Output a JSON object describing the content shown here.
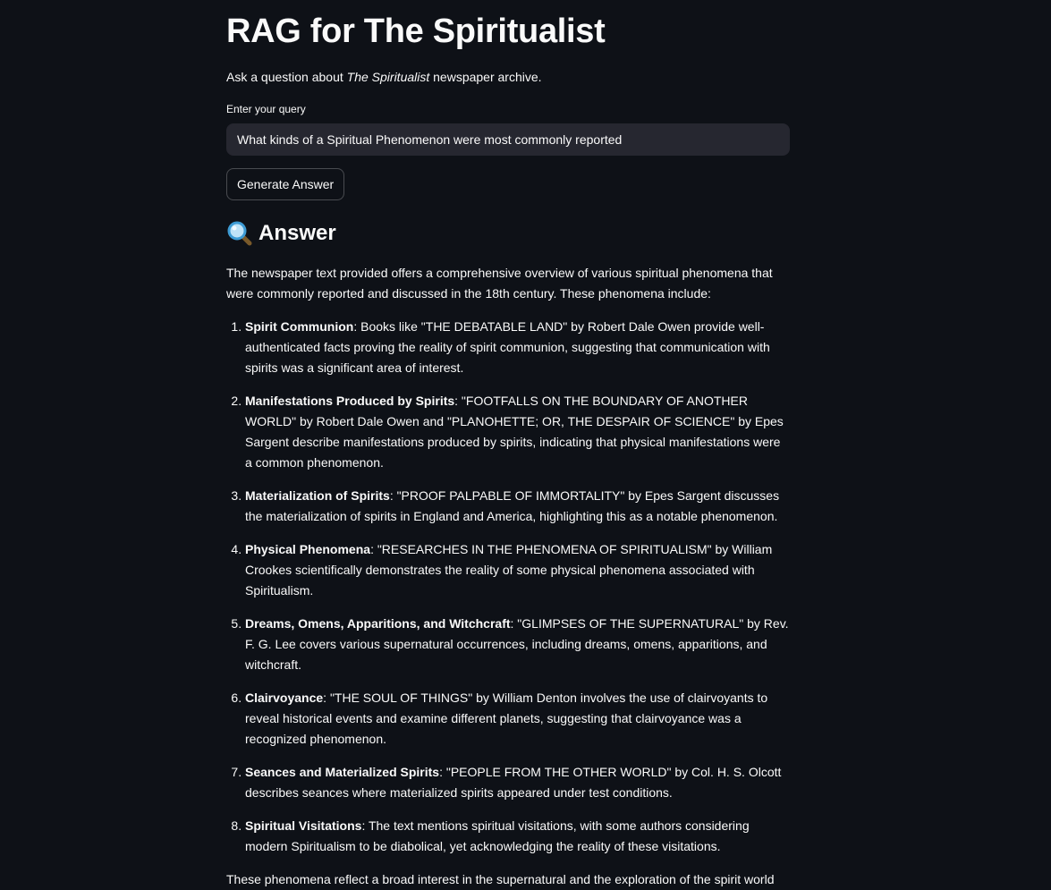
{
  "header": {
    "title": "RAG for The Spiritualist",
    "subtitle_before": "Ask a question about ",
    "subtitle_em": "The Spiritualist",
    "subtitle_after": " newspaper archive."
  },
  "query": {
    "label": "Enter your query",
    "value": "What kinds of a Spiritual Phenomenon were most commonly reported"
  },
  "button": {
    "label": "Generate Answer"
  },
  "answer": {
    "heading": "Answer",
    "icon": "magnifying-glass-icon",
    "intro": "The newspaper text provided offers a comprehensive overview of various spiritual phenomena that were commonly reported and discussed in the 18th century. These phenomena include:",
    "items": [
      {
        "title": "Spirit Communion",
        "text": ": Books like \"THE DEBATABLE LAND\" by Robert Dale Owen provide well-authenticated facts proving the reality of spirit communion, suggesting that communication with spirits was a significant area of interest."
      },
      {
        "title": "Manifestations Produced by Spirits",
        "text": ": \"FOOTFALLS ON THE BOUNDARY OF ANOTHER WORLD\" by Robert Dale Owen and \"PLANOHETTE; OR, THE DESPAIR OF SCIENCE\" by Epes Sargent describe manifestations produced by spirits, indicating that physical manifestations were a common phenomenon."
      },
      {
        "title": "Materialization of Spirits",
        "text": ": \"PROOF PALPABLE OF IMMORTALITY\" by Epes Sargent discusses the materialization of spirits in England and America, highlighting this as a notable phenomenon."
      },
      {
        "title": "Physical Phenomena",
        "text": ": \"RESEARCHES IN THE PHENOMENA OF SPIRITUALISM\" by William Crookes scientifically demonstrates the reality of some physical phenomena associated with Spiritualism."
      },
      {
        "title": "Dreams, Omens, Apparitions, and Witchcraft",
        "text": ": \"GLIMPSES OF THE SUPERNATURAL\" by Rev. F. G. Lee covers various supernatural occurrences, including dreams, omens, apparitions, and witchcraft."
      },
      {
        "title": "Clairvoyance",
        "text": ": \"THE SOUL OF THINGS\" by William Denton involves the use of clairvoyants to reveal historical events and examine different planets, suggesting that clairvoyance was a recognized phenomenon."
      },
      {
        "title": "Seances and Materialized Spirits",
        "text": ": \"PEOPLE FROM THE OTHER WORLD\" by Col. H. S. Olcott describes seances where materialized spirits appeared under test conditions."
      },
      {
        "title": "Spiritual Visitations",
        "text": ": The text mentions spiritual visitations, with some authors considering modern Spiritualism to be diabolical, yet acknowledging the reality of these visitations."
      }
    ],
    "outro": "These phenomena reflect a broad interest in the supernatural and the exploration of the spirit world"
  }
}
